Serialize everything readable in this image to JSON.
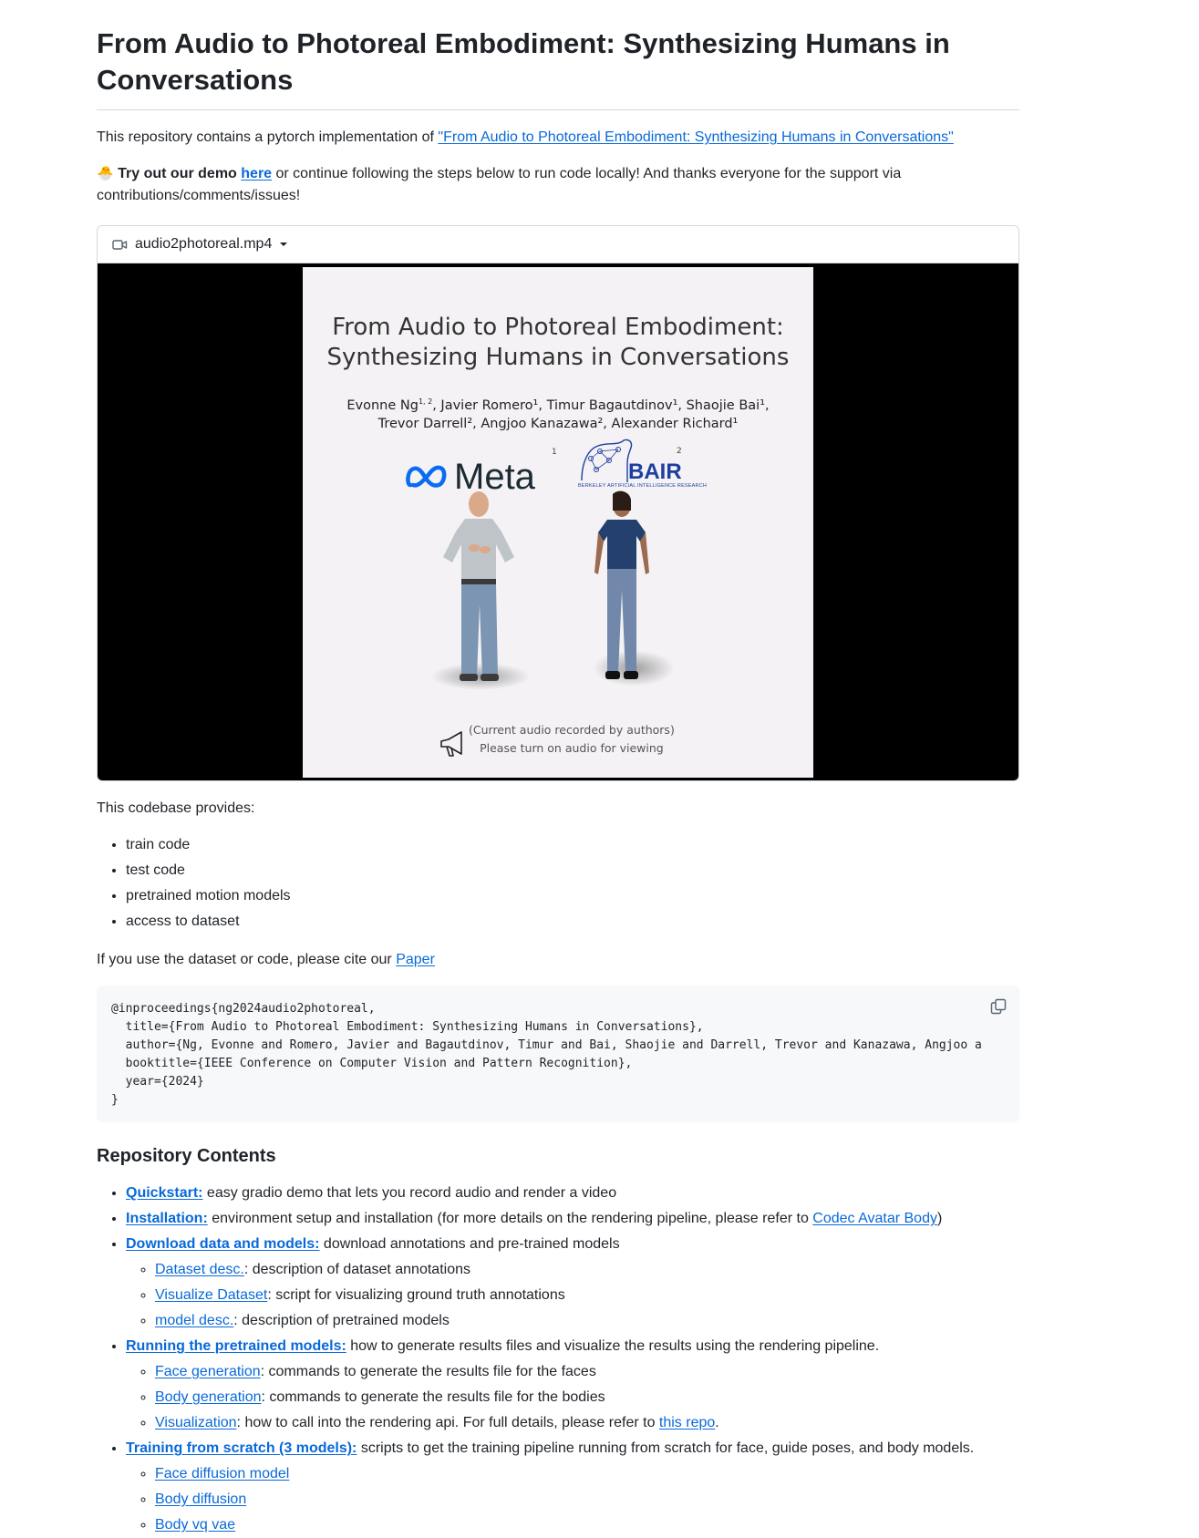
{
  "title": "From Audio to Photoreal Embodiment: Synthesizing Humans in Conversations",
  "intro": {
    "text": "This repository contains a pytorch implementation of ",
    "link": "\"From Audio to Photoreal Embodiment: Synthesizing Humans in Conversations\""
  },
  "demo": {
    "emoji": "🐣",
    "bold": "Try out our demo",
    "link": "here",
    "rest": " or continue following the steps below to run code locally! And thanks everyone for the support via contributions/comments/issues!"
  },
  "video": {
    "filename": "audio2photoreal.mp4",
    "slide": {
      "title_line1": "From Audio to Photoreal Embodiment:",
      "title_line2": "Synthesizing Humans in Conversations",
      "authors_line1": "Evonne Ng",
      "authors_line1_sup": "1, 2",
      "authors_line1_rest": ", Javier Romero¹, Timur Bagautdinov¹, Shaojie Bai¹,",
      "authors_line2": "Trevor Darrell², Angjoo Kanazawa², Alexander Richard¹",
      "meta": "Meta",
      "meta_sup": "1",
      "bair": "BAIR",
      "bair_sub": "BERKELEY ARTIFICIAL INTELLIGENCE RESEARCH",
      "bair_sup": "2",
      "note_line1": "(Current audio recorded by authors)",
      "note_line2": "Please turn on audio for viewing"
    }
  },
  "provides": {
    "heading": "This codebase provides:",
    "items": [
      "train code",
      "test code",
      "pretrained motion models",
      "access to dataset"
    ]
  },
  "cite": {
    "text": "If you use the dataset or code, please cite our ",
    "link": "Paper"
  },
  "bibtex": [
    "@inproceedings{ng2024audio2photoreal,",
    "  title={From Audio to Photoreal Embodiment: Synthesizing Humans in Conversations},",
    "  author={Ng, Evonne and Romero, Javier and Bagautdinov, Timur and Bai, Shaojie and Darrell, Trevor and Kanazawa, Angjoo and Richard, Alexander},",
    "  booktitle={IEEE Conference on Computer Vision and Pattern Recognition},",
    "  year={2024}",
    "}"
  ],
  "contents": {
    "heading": "Repository Contents",
    "quickstart": {
      "link": "Quickstart:",
      "text": " easy gradio demo that lets you record audio and render a video"
    },
    "installation": {
      "link": "Installation:",
      "text": " environment setup and installation (for more details on the rendering pipeline, please refer to ",
      "ref": "Codec Avatar Body",
      "close": ")"
    },
    "download": {
      "link": "Download data and models:",
      "text": " download annotations and pre-trained models",
      "sub": [
        {
          "link": "Dataset desc.",
          "text": ": description of dataset annotations"
        },
        {
          "link": "Visualize Dataset",
          "text": ": script for visualizing ground truth annotations"
        },
        {
          "link": "model desc.",
          "text": ": description of pretrained models"
        }
      ]
    },
    "running": {
      "link": "Running the pretrained models:",
      "text": " how to generate results files and visualize the results using the rendering pipeline.",
      "sub": [
        {
          "link": "Face generation",
          "text": ": commands to generate the results file for the faces"
        },
        {
          "link": "Body generation",
          "text": ": commands to generate the results file for the bodies"
        },
        {
          "link": "Visualization",
          "text": ": how to call into the rendering api. For full details, please refer to ",
          "ref": "this repo",
          "end": "."
        }
      ]
    },
    "training": {
      "link": "Training from scratch (3 models):",
      "text": " scripts to get the training pipeline running from scratch for face, guide poses, and body models.",
      "sub": [
        {
          "link": "Face diffusion model"
        },
        {
          "link": "Body diffusion"
        },
        {
          "link": "Body vq vae"
        }
      ]
    }
  }
}
